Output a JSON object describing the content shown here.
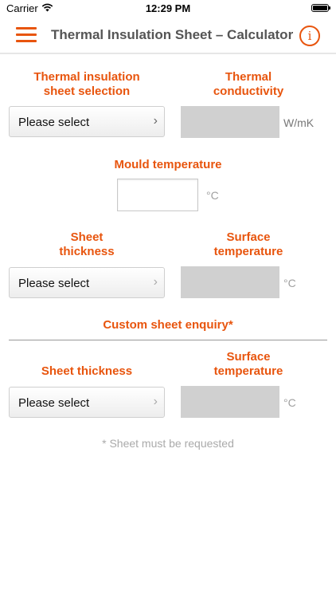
{
  "status_bar": {
    "carrier": "Carrier",
    "time": "12:29 PM"
  },
  "header": {
    "title": "Thermal Insulation Sheet – Calculator",
    "info_symbol": "i"
  },
  "accent_color": "#e8550e",
  "section1": {
    "selection_label_line1": "Thermal insulation",
    "selection_label_line2": "sheet selection",
    "selection_value": "Please select",
    "conductivity_label_line1": "Thermal",
    "conductivity_label_line2": "conductivity",
    "conductivity_unit": "W/mK"
  },
  "mould": {
    "label": "Mould temperature",
    "value": "",
    "unit": "°C"
  },
  "section2": {
    "thickness_label_line1": "Sheet",
    "thickness_label_line2": "thickness",
    "thickness_value": "Please select",
    "surface_label_line1": "Surface",
    "surface_label_line2": "temperature",
    "surface_unit": "°C"
  },
  "custom": {
    "heading": "Custom sheet enquiry*",
    "thickness_label": "Sheet thickness",
    "thickness_value": "Please select",
    "surface_label_line1": "Surface",
    "surface_label_line2": "temperature",
    "surface_unit": "°C",
    "footnote": "* Sheet must be requested"
  },
  "icons": {
    "menu": "hamburger-menu-icon",
    "info": "info-circle-icon",
    "chevron": "chevron-right-icon"
  }
}
